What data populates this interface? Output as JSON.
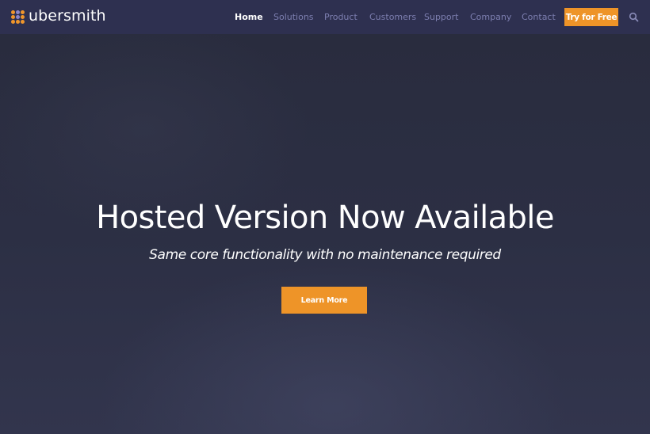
{
  "brand": {
    "name": "ubersmith",
    "logo_icon": "dot-grid-logo-icon",
    "colors": {
      "orange": "#ee9428",
      "purple": "#8c86c8"
    }
  },
  "navbar": {
    "items": [
      {
        "label": "Home",
        "active": true
      },
      {
        "label": "Solutions",
        "active": false
      },
      {
        "label": "Product",
        "active": false
      },
      {
        "label": "Customers",
        "active": false
      },
      {
        "label": "Support",
        "active": false
      },
      {
        "label": "Company",
        "active": false
      },
      {
        "label": "Contact",
        "active": false
      }
    ],
    "cta_label": "Try for Free",
    "search_icon": "search-icon"
  },
  "hero": {
    "title": "Hosted Version Now Available",
    "subtitle": "Same core functionality with no maintenance required",
    "button_label": "Learn More"
  },
  "colors": {
    "navbar_bg": "#2e3050",
    "hero_bg": "#2a2d40",
    "nav_text": "#7d7fb0",
    "nav_active": "#ffffff",
    "accent": "#ee9428"
  }
}
